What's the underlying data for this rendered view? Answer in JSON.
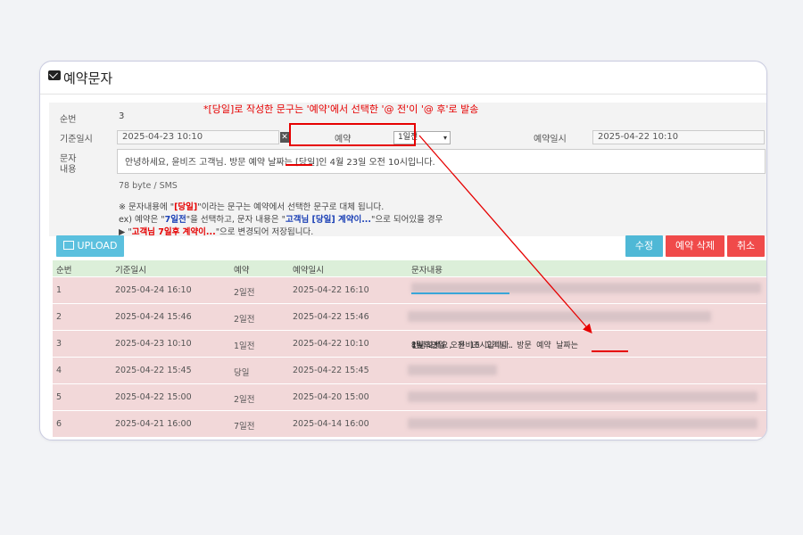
{
  "header": {
    "title": "예약문자"
  },
  "annotation": {
    "text": "*[당일]로 작성한 문구는 '예약'에서 선택한 '@ 전'이 '@ 후'로 발송"
  },
  "form": {
    "seq_label": "순번",
    "seq_value": "3",
    "base_date_label": "기준일시",
    "base_date_value": "2025-04-23 10:10",
    "clear_symbol": "✕",
    "reserve_label": "예약",
    "reserve_selected": "1일전",
    "reserve_date_label": "예약일시",
    "reserve_date_value": "2025-04-22 10:10",
    "message_label_1": "문자",
    "message_label_2": "내용",
    "message_before": "안녕하세요, 윤비즈 고객님. 방문 예약 날짜는 ",
    "message_highlight": "[당일]",
    "message_after": "인 4월 23일 오전 10시입니다.",
    "byte_info": "78 byte / SMS"
  },
  "notes": {
    "line1_a": "※ 문자내용에 \"",
    "line1_tag": "[당일]",
    "line1_b": "\"이라는 문구는 예약에서 선택한 문구로 대체 됩니다.",
    "line2_a": "ex) 예약은 \"",
    "line2_opt": "7일전",
    "line2_b": "\"을 선택하고, 문자 내용은 \"",
    "line2_msg": "고객님 [당일] 계약이...",
    "line2_c": "\"으로 되어있을 경우",
    "line3_a": "▶ \"",
    "line3_msg": "고객님 7일후 계약이...",
    "line3_b": "\"으로 변경되어 저장됩니다."
  },
  "toolbar": {
    "upload_label": "UPLOAD",
    "edit_label": "수정",
    "delete_label": "예약 삭제",
    "cancel_label": "취소"
  },
  "colors": {
    "upload": "#5bc0de",
    "edit": "#4fb8d6",
    "delete": "#f04a4a",
    "cancel": "#f04a4a",
    "row_bg": "#f2d8d9",
    "header_bg": "#dcefd9",
    "annotation": "#e60000"
  },
  "table": {
    "headers": [
      "순번",
      "기준일시",
      "예약",
      "예약일시",
      "문자내용"
    ],
    "rows": [
      {
        "seq": "1",
        "base": "2025-04-24 16:10",
        "reserve": "2일전",
        "reserve_at": "2025-04-22 16:10",
        "message": ""
      },
      {
        "seq": "2",
        "base": "2025-04-24 15:46",
        "reserve": "2일전",
        "reserve_at": "2025-04-22 15:46",
        "message": ""
      },
      {
        "seq": "3",
        "base": "2025-04-23 10:10",
        "reserve": "1일전",
        "reserve_at": "2025-04-22 10:10",
        "message_before": "안녕하세요, 윤비즈 고객님. 방문 예약 날짜는 ",
        "message_highlight": "1일후인",
        "message_after": " 4월 23일 오전 10시입니다."
      },
      {
        "seq": "4",
        "base": "2025-04-22 15:45",
        "reserve": "당일",
        "reserve_at": "2025-04-22 15:45",
        "message": ""
      },
      {
        "seq": "5",
        "base": "2025-04-22 15:00",
        "reserve": "2일전",
        "reserve_at": "2025-04-20 15:00",
        "message": ""
      },
      {
        "seq": "6",
        "base": "2025-04-21 16:00",
        "reserve": "7일전",
        "reserve_at": "2025-04-14 16:00",
        "message": ""
      }
    ]
  }
}
